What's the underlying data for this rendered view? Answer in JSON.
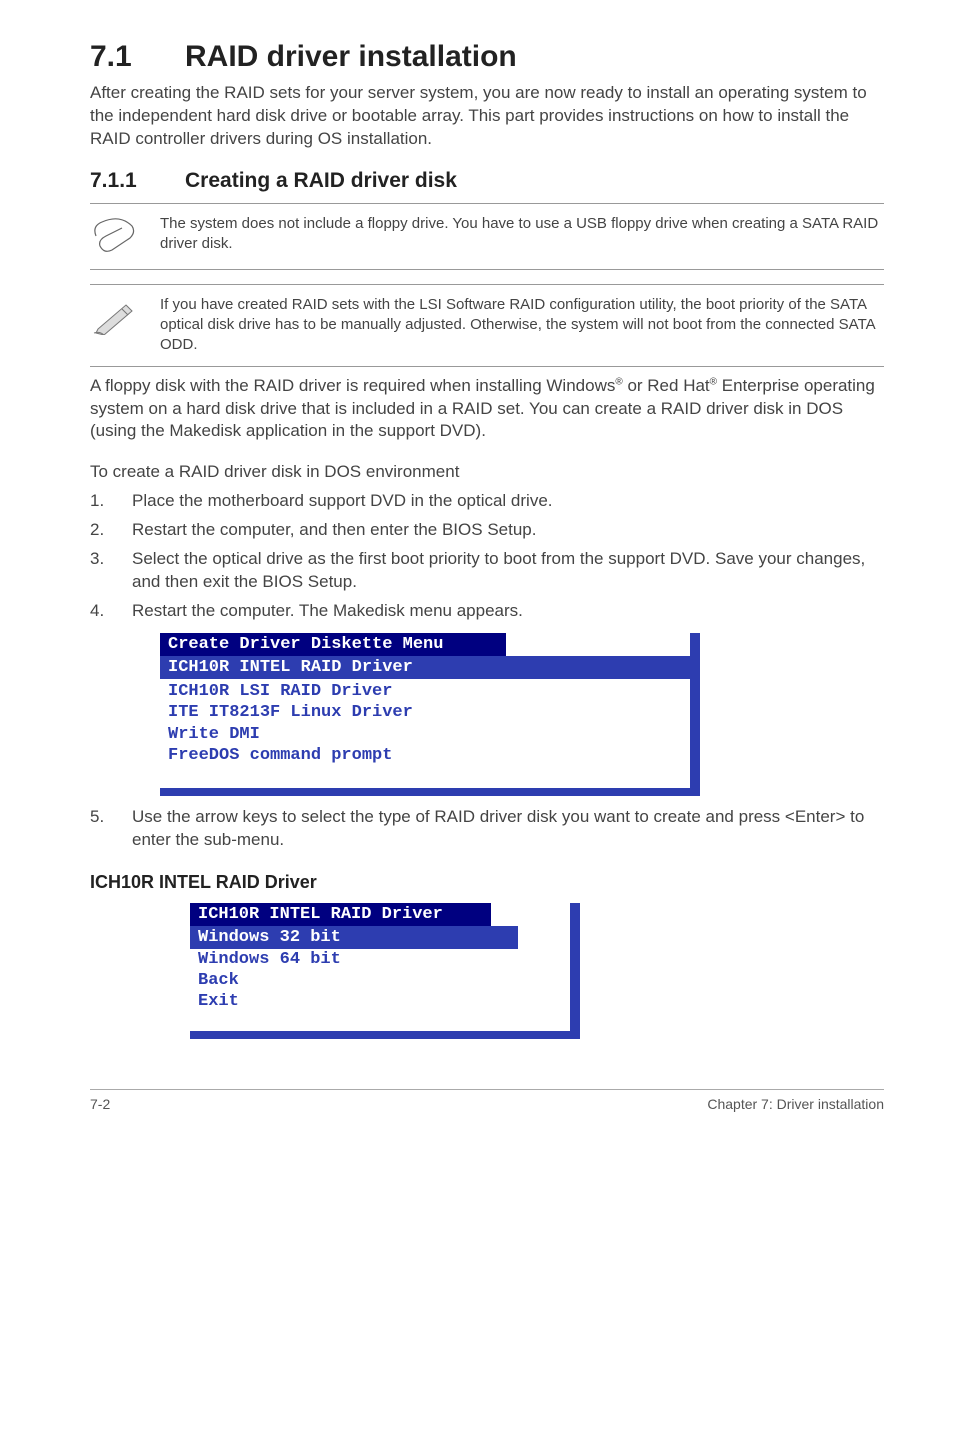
{
  "section": {
    "number": "7.1",
    "title": "RAID driver installation",
    "intro": "After creating the RAID sets for your server system, you are now ready to install an operating system to the independent hard disk drive or bootable array. This part provides instructions on how to install the RAID controller drivers during OS installation."
  },
  "subsection": {
    "number": "7.1.1",
    "title": "Creating a RAID driver disk"
  },
  "notes": {
    "clip": "The system does not include a floppy drive. You have to use a USB floppy drive when creating a SATA RAID driver disk.",
    "pencil": "If you have created RAID sets with the LSI Software RAID configuration utility, the boot priority of the SATA optical disk drive has to be manually adjusted. Otherwise, the system will not boot from the connected SATA ODD."
  },
  "paragraphs": {
    "para2_part1": "A floppy disk with the RAID driver is required when installing Windows",
    "para2_part2": " or Red Hat",
    "para2_part3": " Enterprise operating system on a hard disk drive that is included in a RAID set. You can create a RAID driver disk in DOS (using the Makedisk application in the support DVD).",
    "reg": "®",
    "para3": "To create a RAID driver disk in DOS environment"
  },
  "steps": [
    {
      "n": "1.",
      "t": "Place the motherboard support DVD in the optical drive."
    },
    {
      "n": "2.",
      "t": "Restart the computer, and then enter the BIOS Setup."
    },
    {
      "n": "3.",
      "t": "Select the optical drive as the first boot priority to boot from the support DVD. Save your changes, and then exit the BIOS Setup."
    },
    {
      "n": "4.",
      "t": "Restart the computer. The Makedisk menu appears."
    }
  ],
  "menu": {
    "header": "Create Driver Diskette Menu",
    "selected": "ICH10R INTEL RAID Driver",
    "items": [
      "ICH10R LSI RAID Driver",
      "ITE IT8213F Linux Driver",
      "Write DMI",
      "FreeDOS command prompt"
    ]
  },
  "step5": {
    "n": "5.",
    "t": "Use the arrow keys to select the type of RAID driver disk you want to create and press <Enter> to enter the sub-menu."
  },
  "subheading": "ICH10R INTEL RAID Driver",
  "submenu": {
    "header": "ICH10R INTEL RAID Driver",
    "selected": "Windows 32 bit",
    "items": [
      "Windows 64 bit",
      "Back",
      "Exit"
    ]
  },
  "footer": {
    "left": "7-2",
    "right": "Chapter 7: Driver installation"
  }
}
